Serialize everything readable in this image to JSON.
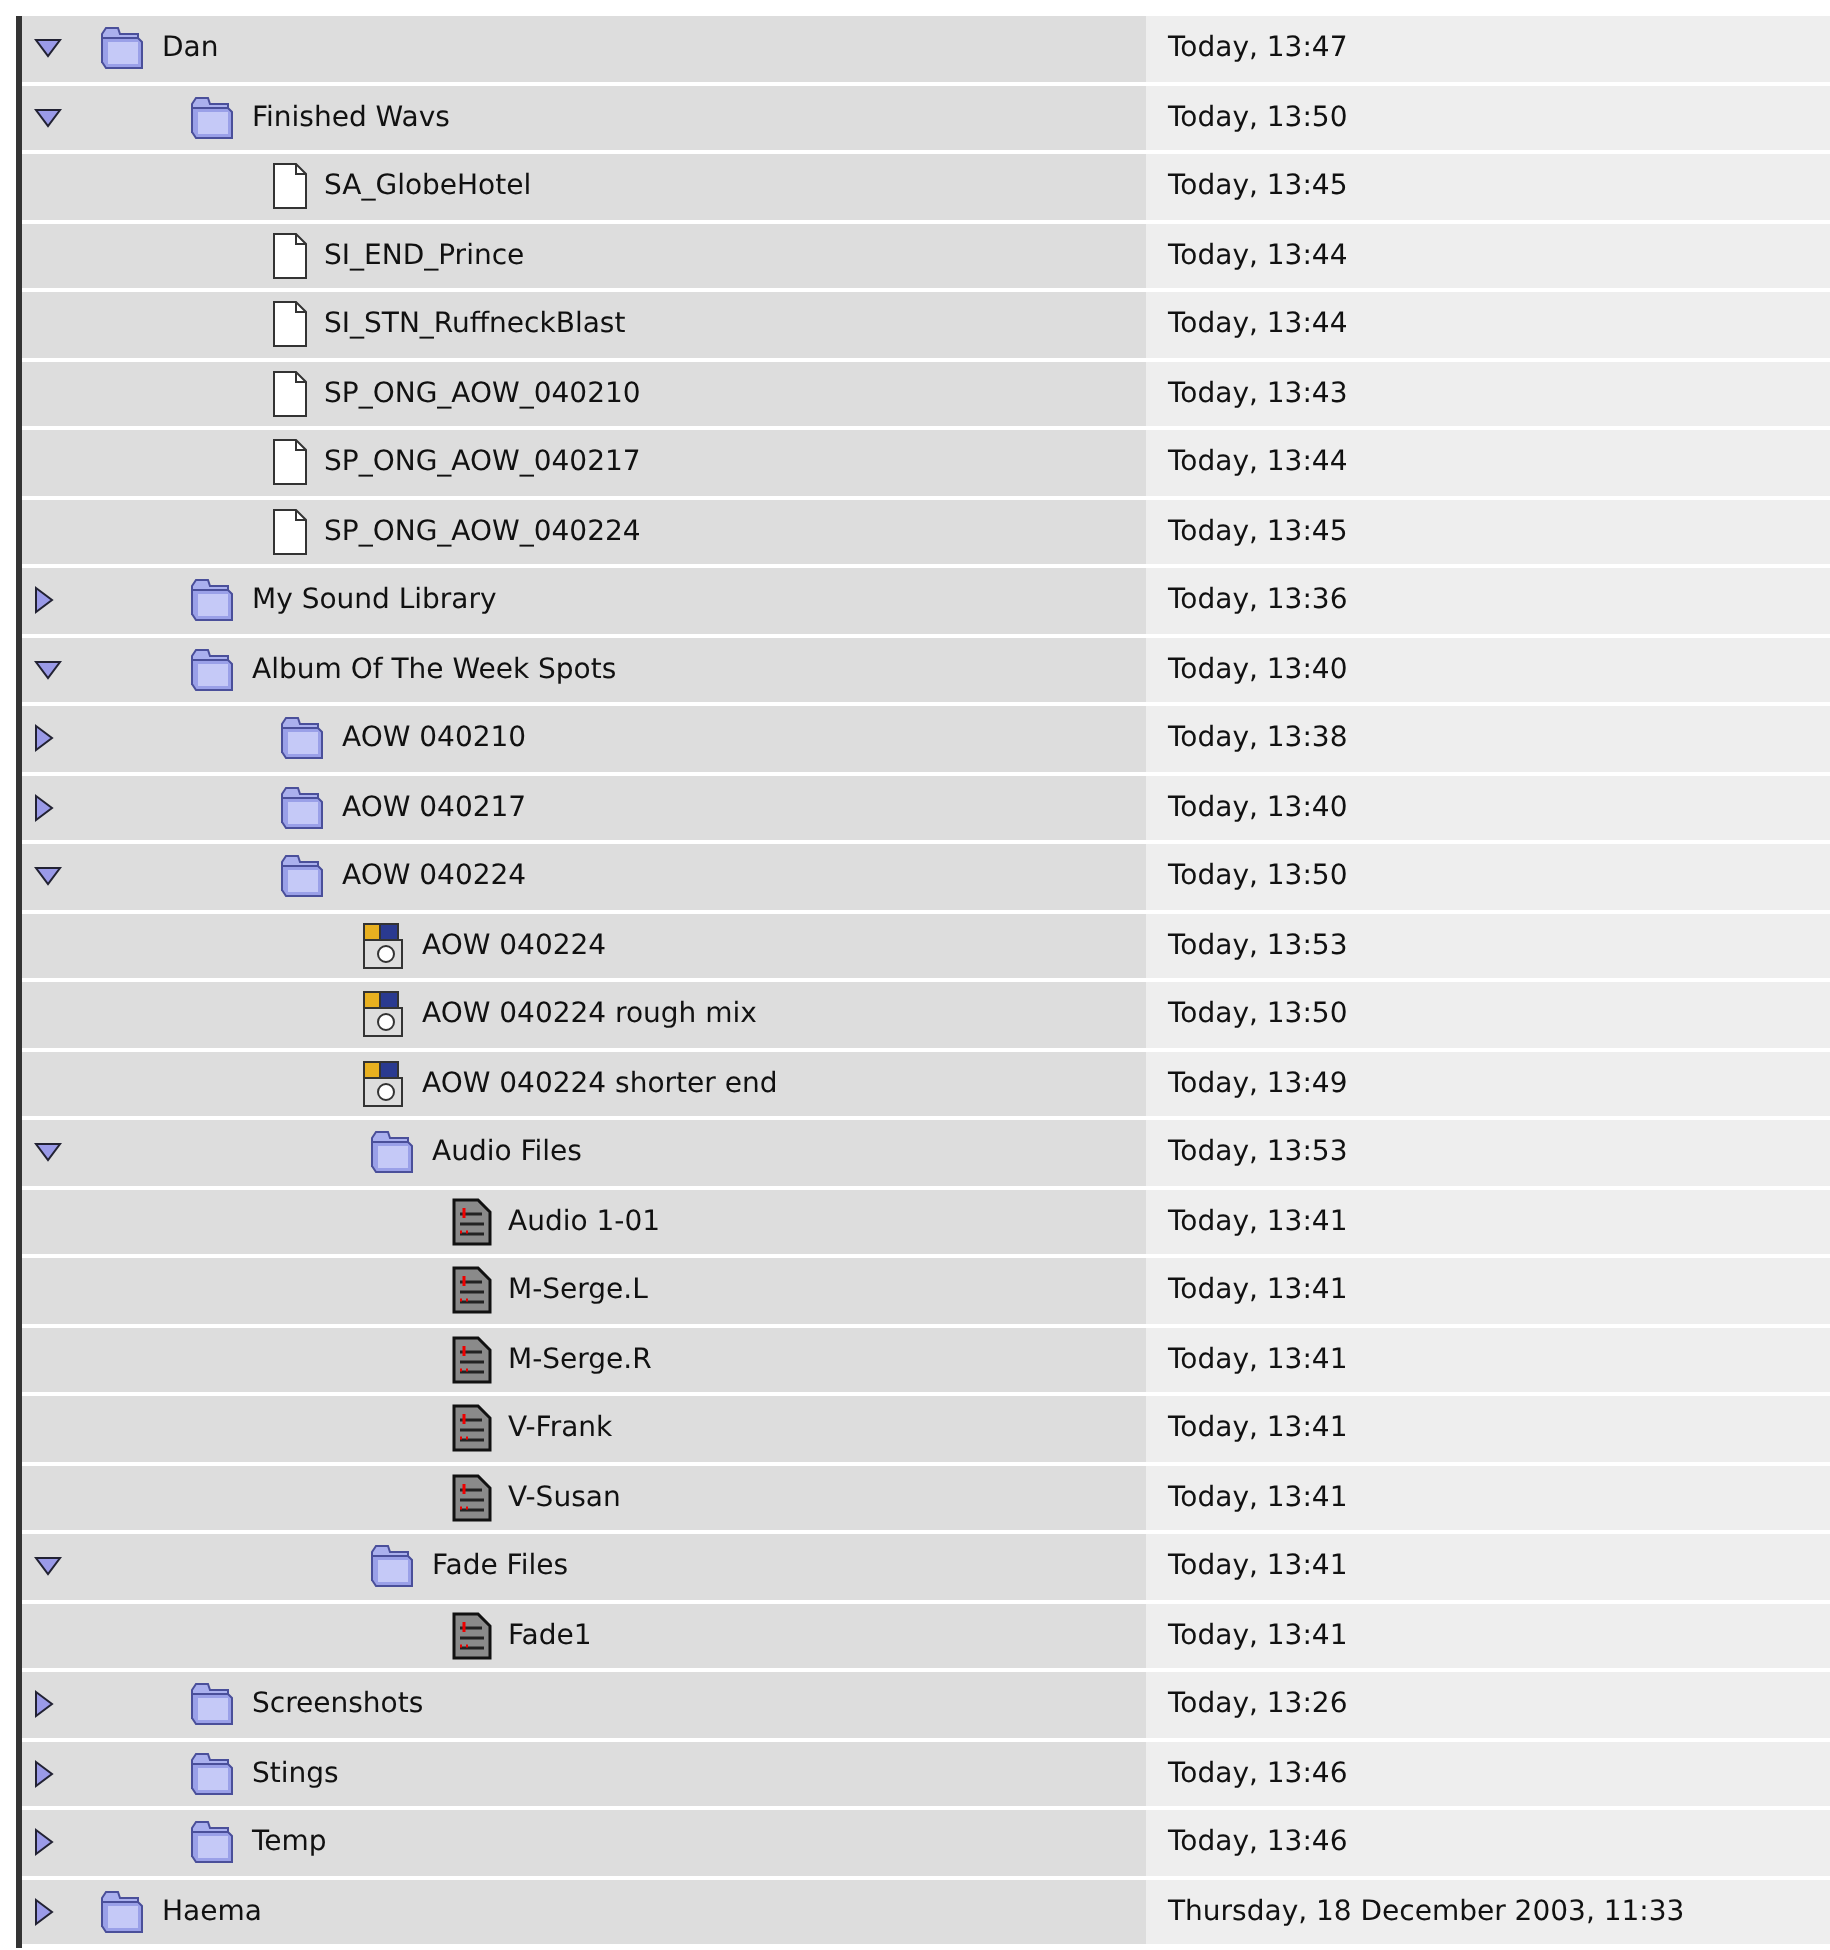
{
  "items": [
    {
      "kind": "folder",
      "name": "Dan",
      "date": "Today, 13:47",
      "expanded": true,
      "children": [
        {
          "kind": "folder",
          "name": "Finished Wavs",
          "date": "Today, 13:50",
          "expanded": true,
          "children": [
            {
              "kind": "document",
              "name": "SA_GlobeHotel",
              "date": "Today, 13:45"
            },
            {
              "kind": "document",
              "name": "SI_END_Prince",
              "date": "Today, 13:44"
            },
            {
              "kind": "document",
              "name": "SI_STN_RuffneckBlast",
              "date": "Today, 13:44"
            },
            {
              "kind": "document",
              "name": "SP_ONG_AOW_040210",
              "date": "Today, 13:43"
            },
            {
              "kind": "document",
              "name": "SP_ONG_AOW_040217",
              "date": "Today, 13:44"
            },
            {
              "kind": "document",
              "name": "SP_ONG_AOW_040224",
              "date": "Today, 13:45"
            }
          ]
        },
        {
          "kind": "folder",
          "name": "My Sound Library",
          "date": "Today, 13:36",
          "expanded": false
        },
        {
          "kind": "folder",
          "name": "Album Of The Week Spots",
          "date": "Today, 13:40",
          "expanded": true,
          "children": [
            {
              "kind": "folder",
              "name": "AOW 040210",
              "date": "Today, 13:38",
              "expanded": false
            },
            {
              "kind": "folder",
              "name": "AOW 040217",
              "date": "Today, 13:40",
              "expanded": false
            },
            {
              "kind": "folder",
              "name": "AOW 040224",
              "date": "Today, 13:50",
              "expanded": true,
              "children": [
                {
                  "kind": "session",
                  "name": "AOW 040224",
                  "date": "Today, 13:53"
                },
                {
                  "kind": "session",
                  "name": "AOW 040224 rough mix",
                  "date": "Today, 13:50"
                },
                {
                  "kind": "session",
                  "name": "AOW 040224 shorter end",
                  "date": "Today, 13:49"
                },
                {
                  "kind": "folder",
                  "name": "Audio Files",
                  "date": "Today, 13:53",
                  "expanded": true,
                  "children": [
                    {
                      "kind": "audio",
                      "name": "Audio 1-01",
                      "date": "Today, 13:41"
                    },
                    {
                      "kind": "audio",
                      "name": "M-Serge.L",
                      "date": "Today, 13:41"
                    },
                    {
                      "kind": "audio",
                      "name": "M-Serge.R",
                      "date": "Today, 13:41"
                    },
                    {
                      "kind": "audio",
                      "name": "V-Frank",
                      "date": "Today, 13:41"
                    },
                    {
                      "kind": "audio",
                      "name": "V-Susan",
                      "date": "Today, 13:41"
                    }
                  ]
                },
                {
                  "kind": "folder",
                  "name": "Fade Files",
                  "date": "Today, 13:41",
                  "expanded": true,
                  "children": [
                    {
                      "kind": "audio",
                      "name": "Fade1",
                      "date": "Today, 13:41"
                    }
                  ]
                }
              ]
            }
          ]
        },
        {
          "kind": "folder",
          "name": "Screenshots",
          "date": "Today, 13:26",
          "expanded": false
        },
        {
          "kind": "folder",
          "name": "Stings",
          "date": "Today, 13:46",
          "expanded": false
        },
        {
          "kind": "folder",
          "name": "Temp",
          "date": "Today, 13:46",
          "expanded": false
        }
      ]
    },
    {
      "kind": "folder",
      "name": "Haema",
      "date": "Thursday, 18 December 2003, 11:33",
      "expanded": false
    }
  ]
}
